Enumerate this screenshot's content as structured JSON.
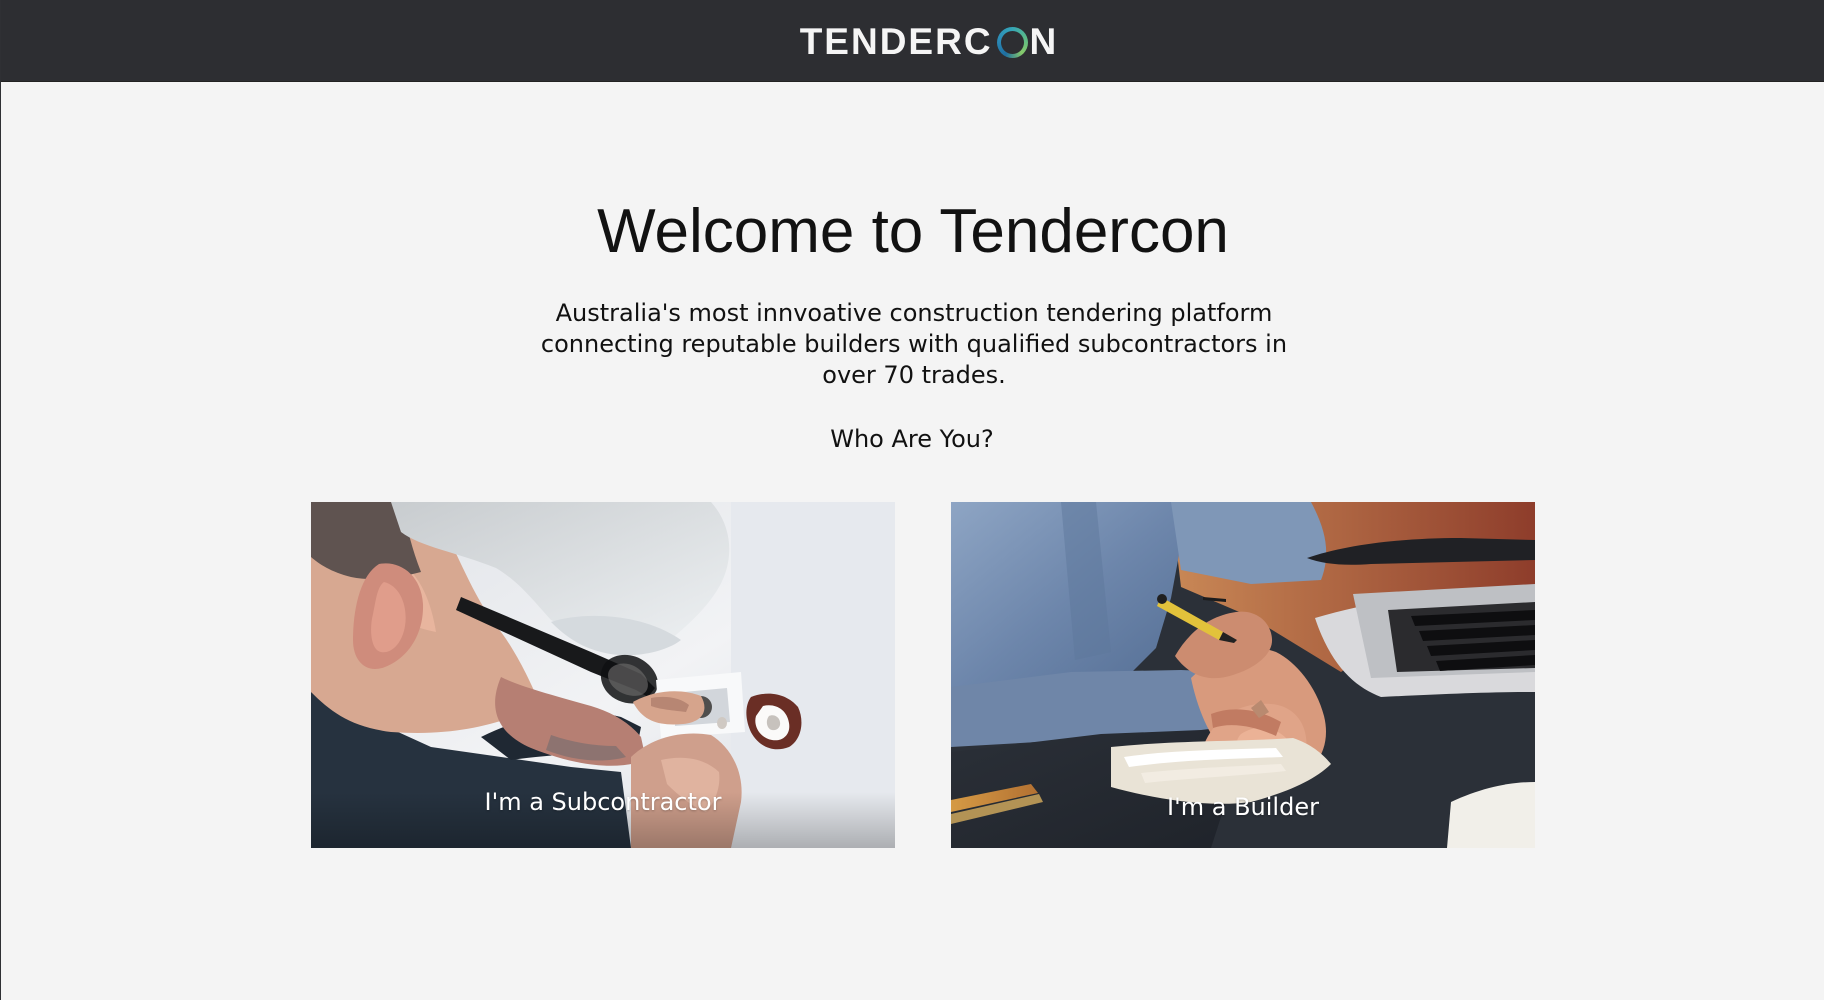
{
  "header": {
    "logo_text_left": "TENDERC",
    "logo_text_right": "N"
  },
  "hero": {
    "title": "Welcome to Tendercon",
    "description": "Australia's most innvoative construction tendering platform connecting reputable builders with qualified subcontractors in over 70 trades.",
    "question": "Who Are You?"
  },
  "options": {
    "subcontractor_label": "I'm a Subcontractor",
    "builder_label": "I'm a Builder"
  },
  "colors": {
    "header_bg": "#2d2e32",
    "page_bg": "#f4f4f4"
  }
}
